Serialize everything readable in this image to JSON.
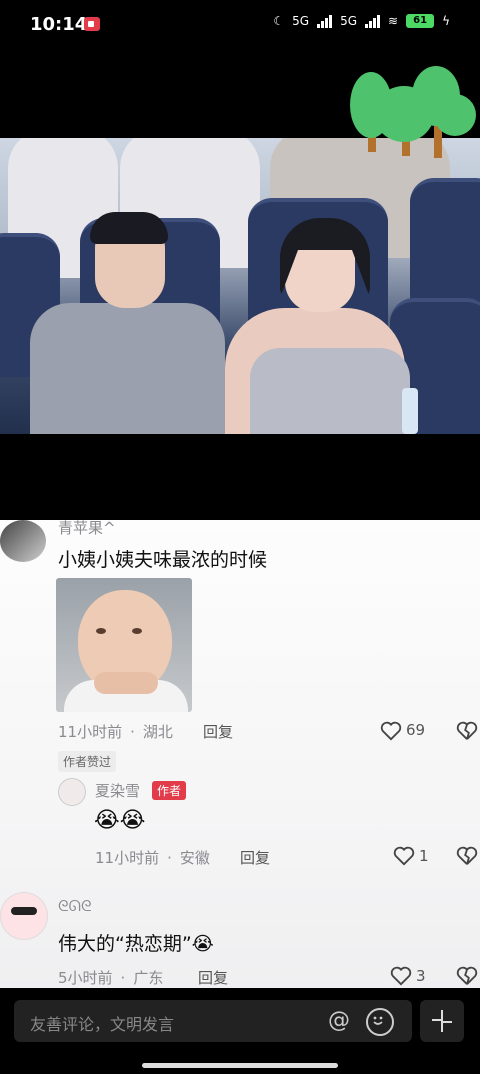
{
  "status_bar": {
    "time": "10:14",
    "network1": "5G",
    "network2": "5G",
    "battery": "61"
  },
  "video": {
    "overlay": "tree-sticker"
  },
  "comments": [
    {
      "user": "青苹果^",
      "text": "小姨小姨夫味最浓的时候",
      "time": "11小时前",
      "location": "湖北",
      "reply_label": "回复",
      "likes": "69",
      "badge": "作者赞过",
      "replies": [
        {
          "user": "夏染雪",
          "author_tag": "作者",
          "emoji": "😭😭",
          "time": "11小时前",
          "location": "安徽",
          "reply_label": "回复",
          "likes": "1"
        }
      ]
    },
    {
      "user": "ᘓᘏᘓ",
      "text": "伟大的“热恋期”😭",
      "time": "5小时前",
      "location": "广东",
      "reply_label": "回复",
      "likes": "3"
    }
  ],
  "input": {
    "placeholder": "友善评论，文明发言"
  },
  "icons": {
    "at": "@"
  }
}
